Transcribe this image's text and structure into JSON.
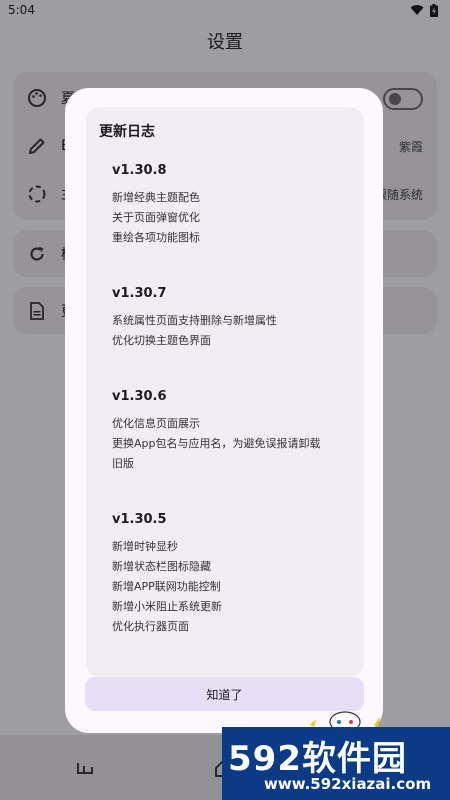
{
  "status_bar": {
    "time": "5:04"
  },
  "app_bar": {
    "title": "设置"
  },
  "settings": {
    "rows": [
      {
        "label": "夏",
        "value": "",
        "icon": "palette-icon"
      },
      {
        "label": "E",
        "value": "紫霞",
        "icon": "pencil-icon"
      },
      {
        "label": "主",
        "value": "跟随系统",
        "icon": "dashed-circle-icon"
      },
      {
        "label": "检",
        "value": "",
        "icon": "refresh-icon"
      },
      {
        "label": "更",
        "value": "",
        "icon": "document-icon"
      }
    ]
  },
  "dialog": {
    "title": "更新日志",
    "entries": [
      {
        "version": "v1.30.8",
        "notes": [
          "新增经典主题配色",
          "关于页面弹窗优化",
          "重绘各项功能图标"
        ]
      },
      {
        "version": "v1.30.7",
        "notes": [
          "系统属性页面支持删除与新增属性",
          "优化切换主题色界面"
        ]
      },
      {
        "version": "v1.30.6",
        "notes": [
          "优化信息页面展示",
          "更换App包名与应用名，为避免误报请卸载",
          "旧版"
        ]
      },
      {
        "version": "v1.30.5",
        "notes": [
          "新增时钟显秒",
          "新增状态栏图标隐藏",
          "新增APP联网功能控制",
          "新增小米阻止系统更新",
          "优化执行器页面"
        ]
      }
    ],
    "confirm_label": "知道了"
  },
  "watermark": {
    "logo_text": "592软件园",
    "url": "www.592xiazai.com"
  },
  "colors": {
    "accent_button": "#e8def6",
    "dialog_surface": "#fdf8fd",
    "watermark_bg": "#0b3a86",
    "watermark_accent": "#ff4e2b"
  }
}
